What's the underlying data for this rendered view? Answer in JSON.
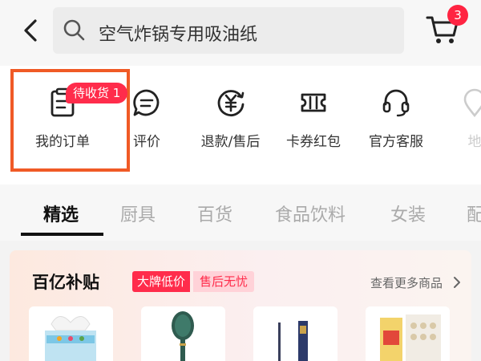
{
  "search": {
    "query": "空气炸锅专用吸油纸"
  },
  "cart": {
    "badge_count": "3"
  },
  "shortcuts": [
    {
      "label": "我的订单",
      "icon": "order-list-icon"
    },
    {
      "label": "评价",
      "icon": "review-chat-icon"
    },
    {
      "label": "退款/售后",
      "icon": "refund-yen-icon"
    },
    {
      "label": "卡券红包",
      "icon": "coupon-ticket-icon"
    },
    {
      "label": "官方客服",
      "icon": "headset-icon"
    },
    {
      "label": "地",
      "icon": "location-icon"
    }
  ],
  "order_badge": "待收货 1",
  "tabs": [
    "精选",
    "厨具",
    "百货",
    "食品饮料",
    "女装",
    "配"
  ],
  "active_tab": 0,
  "subsidy": {
    "title": "百亿补贴",
    "tag_primary": "大牌低价",
    "tag_secondary": "售后无忧",
    "more_label": "查看更多商品"
  },
  "colors": {
    "accent_red": "#ff2c4b",
    "highlight_orange": "#f05a26"
  }
}
